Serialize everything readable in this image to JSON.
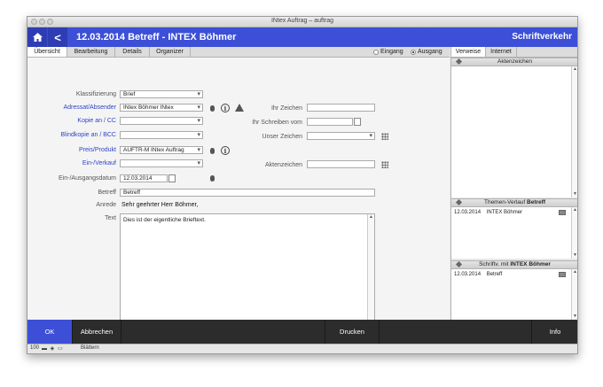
{
  "window": {
    "title": "INtex Auftrag – auftrag"
  },
  "header": {
    "title": "12.03.2014 Betreff - INTEX Böhmer",
    "section": "Schriftverkehr"
  },
  "accent_colors": [
    "#3c4fd6",
    "#2fa84f",
    "#f0a020",
    "#e03030",
    "#a040c0",
    "#f0d020"
  ],
  "tabs": [
    {
      "label": "Übersicht"
    },
    {
      "label": "Bearbeitung"
    },
    {
      "label": "Details"
    },
    {
      "label": "Organizer"
    }
  ],
  "direction": {
    "eingang": "Eingang",
    "ausgang": "Ausgang",
    "selected": "Ausgang"
  },
  "form": {
    "klassifizierung": {
      "label": "Klassifizierung",
      "value": "Brief"
    },
    "adressat": {
      "label": "Adressat/Absender",
      "value": "INtex Böhmer INtex"
    },
    "kopie": {
      "label": "Kopie an / CC",
      "value": ""
    },
    "blindkopie": {
      "label": "Blindkopie an / BCC",
      "value": ""
    },
    "preis": {
      "label": "Preis/Produkt",
      "value": "AUFTR-M INtex Auftrag"
    },
    "einverkauf": {
      "label": "Ein-/Verkauf",
      "value": ""
    },
    "datum": {
      "label": "Ein-/Ausgangsdatum",
      "value": "12.03.2014"
    },
    "betreff": {
      "label": "Betreff",
      "value": "Betreff"
    },
    "anrede": {
      "label": "Anrede",
      "value": "Sehr geehrter Herr Böhmer,"
    },
    "text": {
      "label": "Text",
      "value": "Dies ist der eigentliche Brieftext."
    },
    "ihr_zeichen": {
      "label": "Ihr Zeichen",
      "value": ""
    },
    "ihr_schreiben": {
      "label": "Ihr Schreiben vom",
      "value": ""
    },
    "unser_zeichen": {
      "label": "Unser Zeichen",
      "value": ""
    },
    "aktenzeichen": {
      "label": "Aktenzeichen",
      "value": ""
    }
  },
  "sidebar": {
    "tabs": [
      {
        "label": "Verweise"
      },
      {
        "label": "Internet"
      }
    ],
    "aktenzeichen_title": "Aktenzeichen",
    "themen_title_prefix": "Themen-Verlauf ",
    "themen_title_bold": "Betreff",
    "themen_rows": [
      {
        "date": "12.03.2014",
        "text": "INTEX Böhmer"
      }
    ],
    "schriftv_title_prefix": "Schriftv. mit ",
    "schriftv_title_bold": "INTEX Böhmer",
    "schriftv_rows": [
      {
        "date": "12.03.2014",
        "text": "Betreff"
      }
    ]
  },
  "footer": {
    "ok": "OK",
    "abbrechen": "Abbrechen",
    "drucken": "Drucken",
    "info": "Info"
  },
  "status": {
    "zoom": "100",
    "mode": "Blättern"
  },
  "icons": [
    "home-icon",
    "back-icon",
    "info-icon",
    "warning-icon",
    "mouse-icon",
    "grid-icon",
    "calendar-icon"
  ]
}
